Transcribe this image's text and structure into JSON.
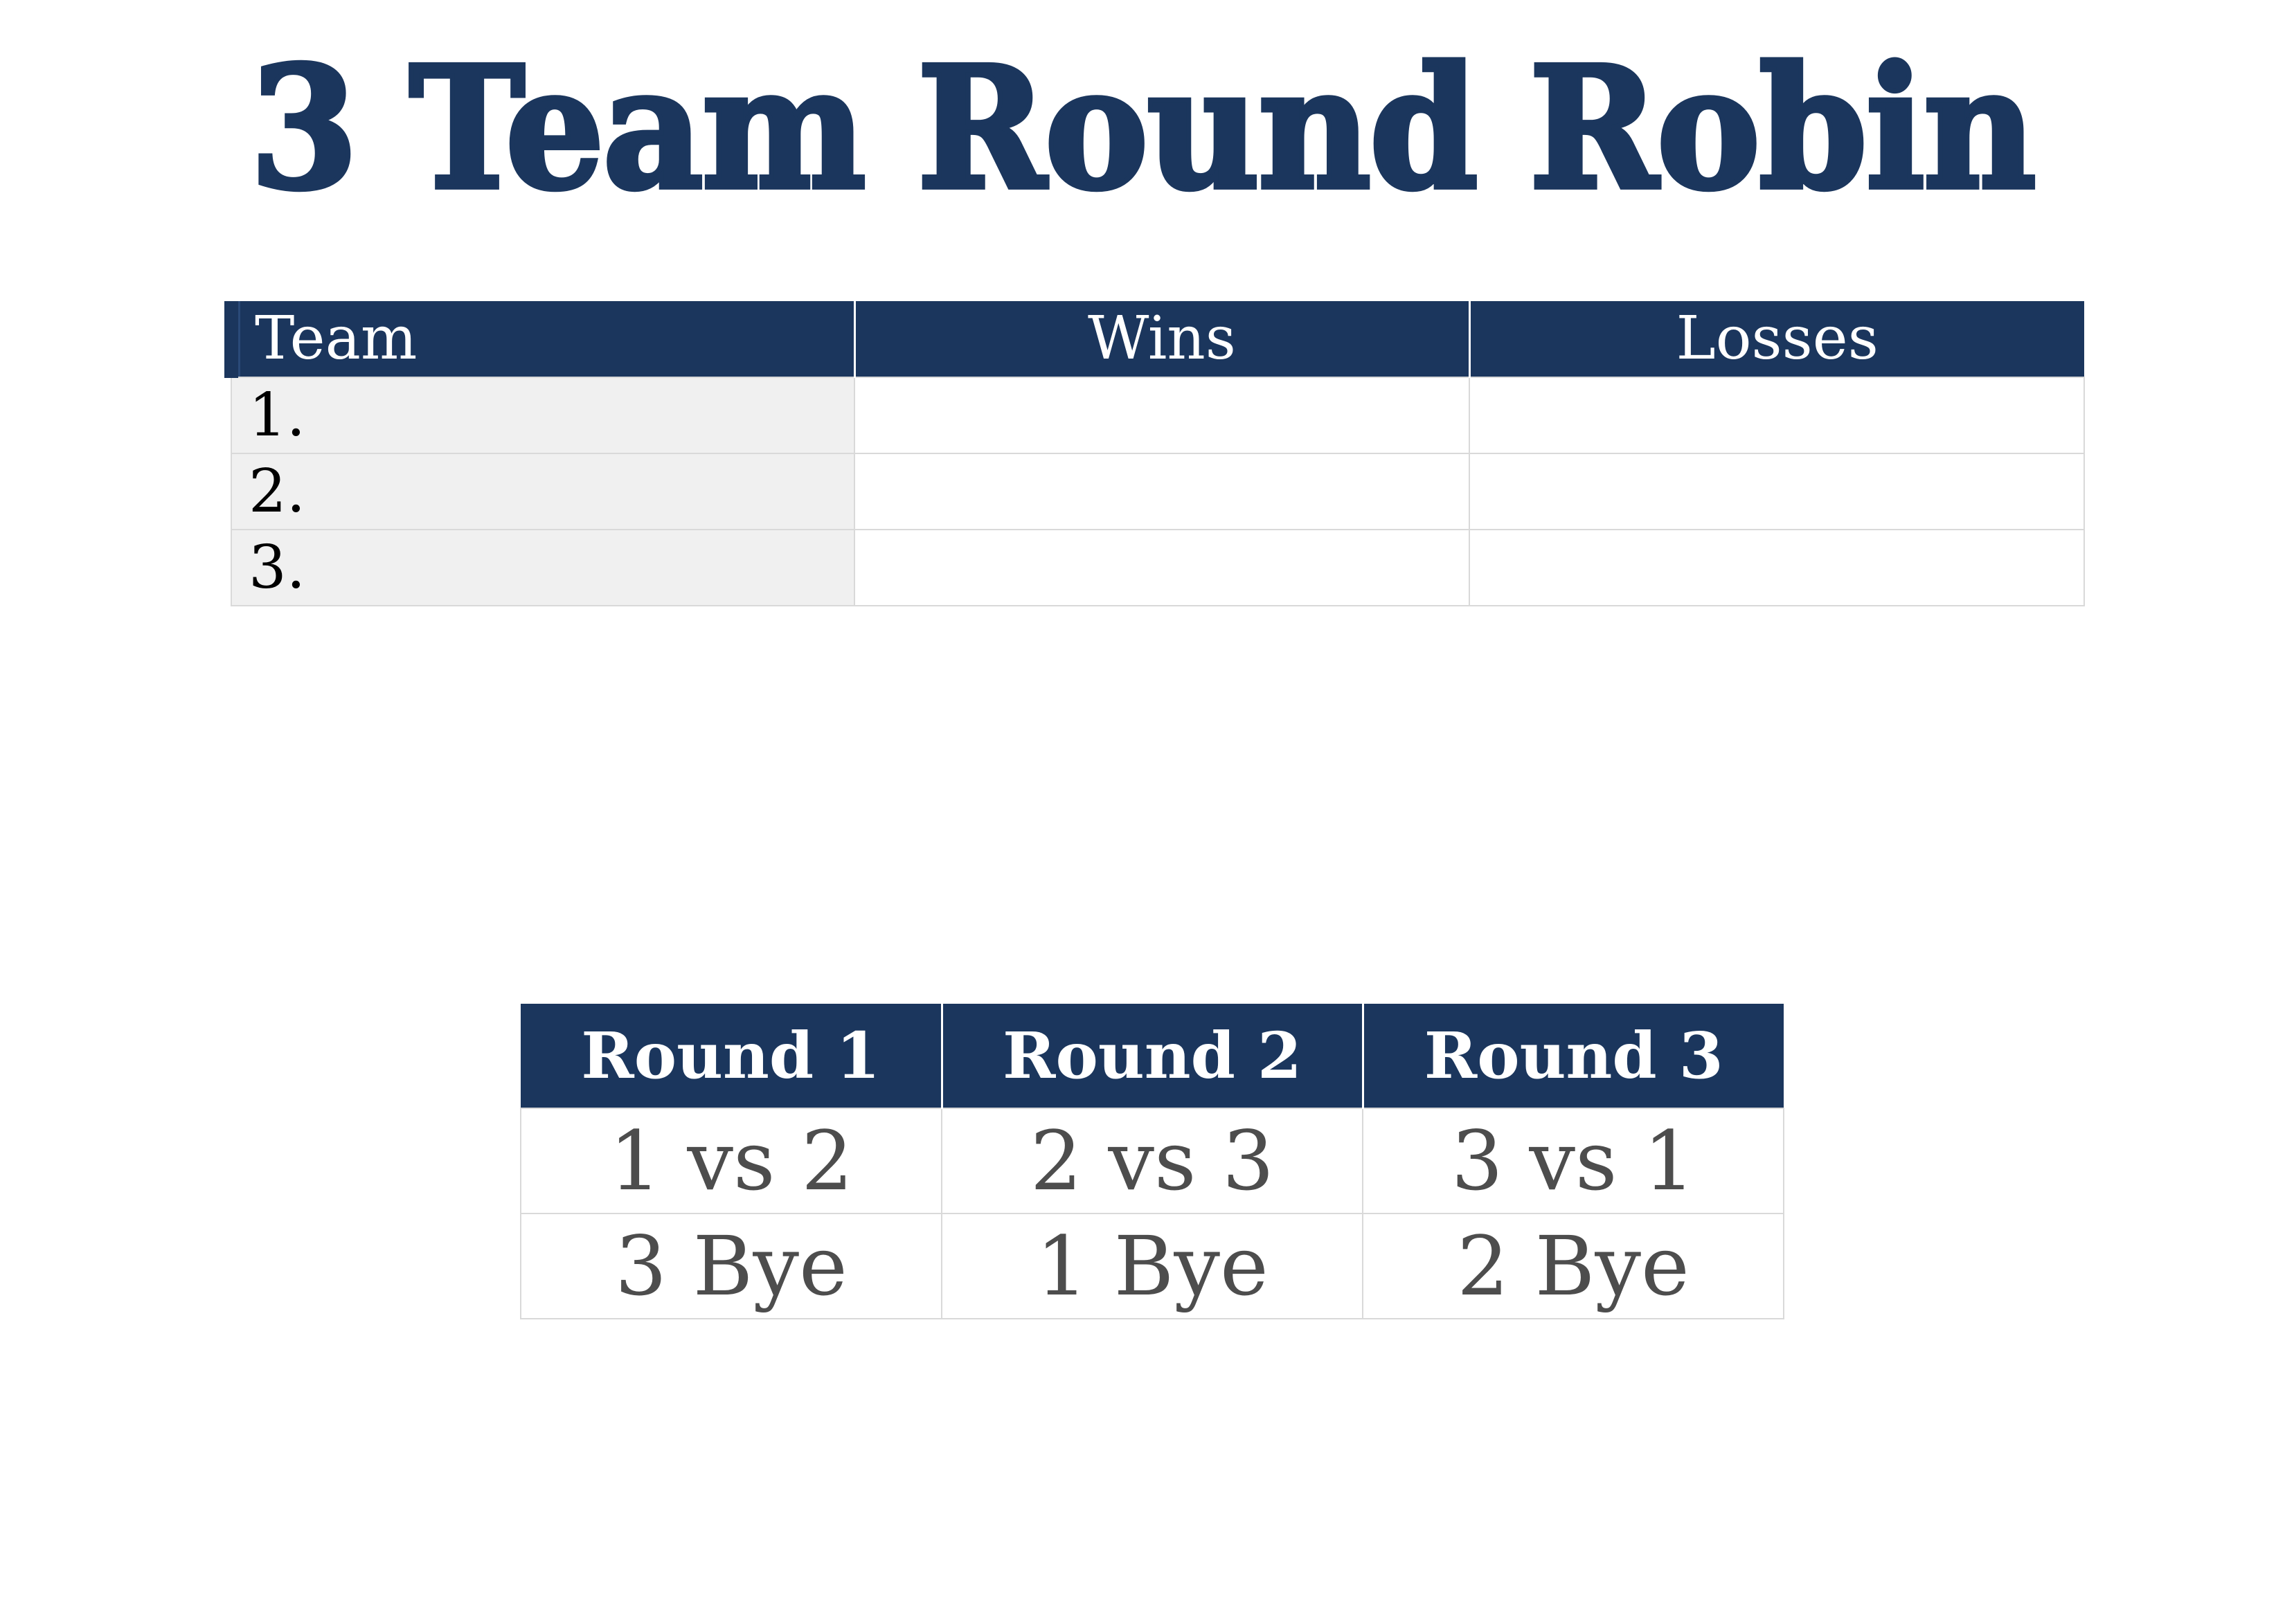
{
  "title": "3 Team Round Robin",
  "standings": {
    "headers": {
      "team": "Team",
      "wins": "Wins",
      "losses": "Losses"
    },
    "rows": [
      {
        "team": "1.",
        "wins": "",
        "losses": ""
      },
      {
        "team": "2.",
        "wins": "",
        "losses": ""
      },
      {
        "team": "3.",
        "wins": "",
        "losses": ""
      }
    ]
  },
  "schedule": {
    "headers": [
      "Round 1",
      "Round 2",
      "Round 3"
    ],
    "matchups": [
      "1 vs 2",
      "2 vs 3",
      "3 vs 1"
    ],
    "byes": [
      "3 Bye",
      "1 Bye",
      "2 Bye"
    ]
  },
  "colors": {
    "header_bg": "#1b365d",
    "title": "#1b365d",
    "team_cell_bg": "#f0f0f0",
    "grid_line": "#d9d9d9",
    "schedule_text": "#4d4d4d"
  }
}
